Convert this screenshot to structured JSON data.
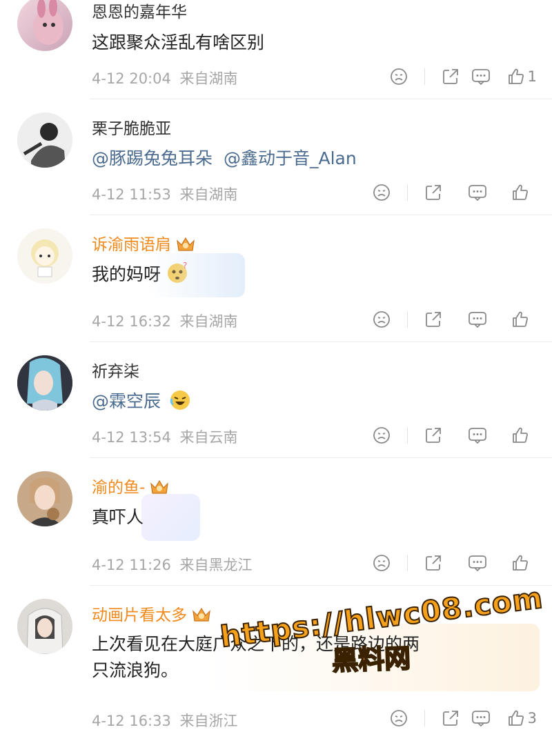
{
  "comments": [
    {
      "user": "恩恩的嘉年华",
      "text": "这跟聚众淫乱有啥区别",
      "time": "4-12 20:04",
      "location": "来自湖南",
      "likes": "1"
    },
    {
      "user": "栗子脆脆亚",
      "mention1": "@豚踢兔兔耳朵",
      "mention2": "@鑫动于音_Alan",
      "time": "4-12 11:53",
      "location": "来自湖南",
      "likes": ""
    },
    {
      "user": "诉渝雨语肩",
      "text": "我的妈呀",
      "time": "4-12 16:32",
      "location": "来自湖南",
      "likes": ""
    },
    {
      "user": "祈弃柒",
      "mention1": "@霖空辰",
      "time": "4-12 13:54",
      "location": "来自云南",
      "likes": ""
    },
    {
      "user": "渝的鱼-",
      "text": "真吓人",
      "time": "4-12 11:26",
      "location": "来自黑龙江",
      "likes": ""
    },
    {
      "user": "动画片看太多",
      "text_line1": "上次看见在大庭广众之下的",
      "text_line1_tail": "，还是路边的两",
      "text_line2": "只流浪狗。",
      "time": "4-12 16:33",
      "location": "来自浙江",
      "likes": "3"
    }
  ],
  "watermark": {
    "url": "https://hlwc08.com",
    "site": "黑料网"
  },
  "colors": {
    "vip_name": "#f08a1c",
    "mention": "#4a6b8f",
    "meta": "#a6a6a6"
  },
  "icons": [
    "dislike-face-icon",
    "share-icon",
    "comment-icon",
    "thumbs-up-icon",
    "vip-crown-icon"
  ]
}
